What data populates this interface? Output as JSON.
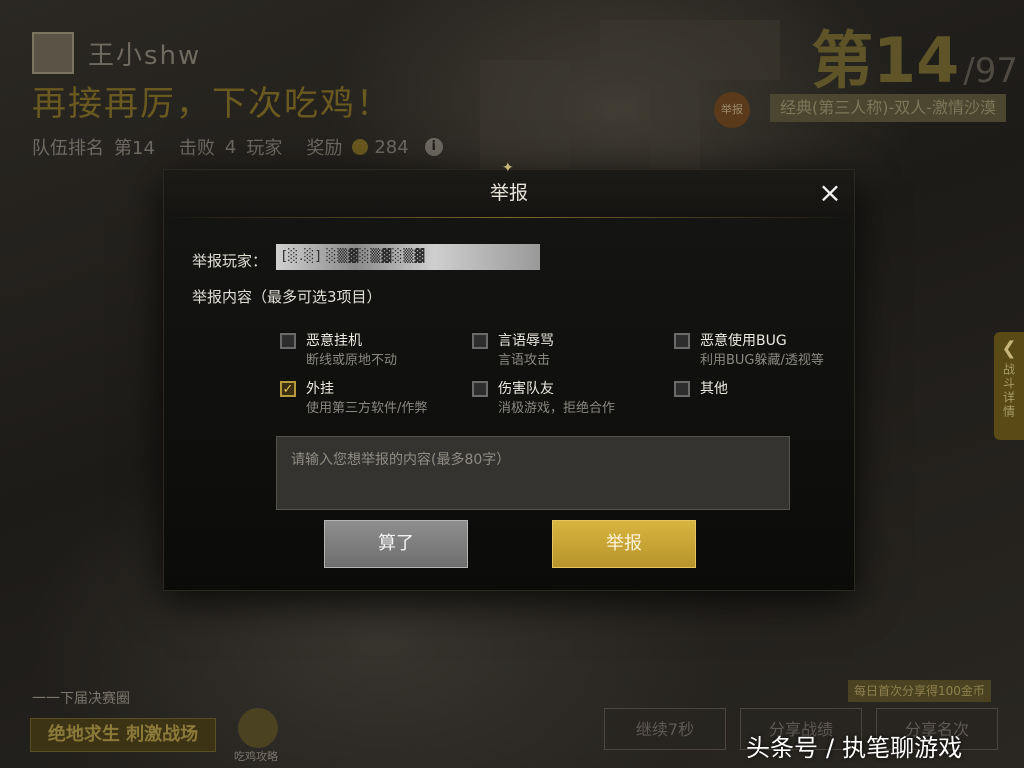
{
  "background": {
    "player_name": "王小shw",
    "headline": "再接再厉，下次吃鸡！",
    "stats": {
      "team_rank_label": "队伍排名",
      "team_rank_value": "第14",
      "kills_label": "击败",
      "kills_value": "4",
      "kills_unit": "玩家",
      "reward_label": "奖励",
      "reward_value": "284"
    },
    "rank_big": "第14",
    "rank_total": "/97",
    "report_badge": "举报",
    "mode": "经典(第三人称)-双人-激情沙漠",
    "side_tab": "战斗详情",
    "bottom_left_text": "一一下届决赛圈",
    "game_logo": "绝地求生 刺激战场",
    "guide_label": "吃鸡攻略",
    "share_tip": "每日首次分享得100金币",
    "continue_btn": "继续7秒",
    "share_btn_1": "分享战绩",
    "share_btn_2": "分享名次",
    "watermark_left": "头条号",
    "watermark_sep": "/",
    "watermark_right": "执笔聊游戏"
  },
  "modal": {
    "title": "举报",
    "close": "×",
    "player_label": "举报玩家：",
    "player_value": "[░.░] ░▒▓░▒▓░▒▓",
    "content_label": "举报内容（最多可选3项目）",
    "options": [
      {
        "title": "恶意挂机",
        "desc": "断线或原地不动",
        "checked": false
      },
      {
        "title": "言语辱骂",
        "desc": "言语攻击",
        "checked": false
      },
      {
        "title": "恶意使用BUG",
        "desc": "利用BUG躲藏/透视等",
        "checked": false
      },
      {
        "title": "外挂",
        "desc": "使用第三方软件/作弊",
        "checked": true
      },
      {
        "title": "伤害队友",
        "desc": "消极游戏，拒绝合作",
        "checked": false
      },
      {
        "title": "其他",
        "desc": "",
        "checked": false
      }
    ],
    "textarea_placeholder": "请输入您想举报的内容(最多80字）",
    "cancel_label": "算了",
    "submit_label": "举报"
  },
  "colors": {
    "accent_gold": "#d0ad3c",
    "cancel_gray": "#7e7e7e"
  }
}
